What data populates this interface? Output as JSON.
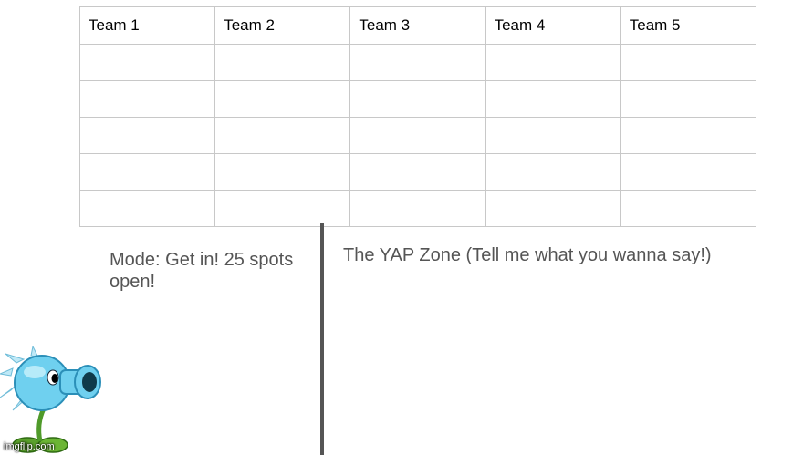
{
  "table": {
    "headers": [
      "Team 1",
      "Team 2",
      "Team 3",
      "Team 4",
      "Team 5"
    ],
    "rows": [
      [
        "",
        "",
        "",
        "",
        ""
      ],
      [
        "",
        "",
        "",
        "",
        ""
      ],
      [
        "",
        "",
        "",
        "",
        ""
      ],
      [
        "",
        "",
        "",
        "",
        ""
      ],
      [
        "",
        "",
        "",
        "",
        ""
      ]
    ]
  },
  "mode_text": "Mode: Get in! 25 spots open!",
  "yap_zone_text": "The YAP Zone (Tell me what you wanna say!)",
  "image": {
    "icon": "snow-pea-plant-icon"
  },
  "watermark": "imgflip.com",
  "colors": {
    "grid": "#c8c8c8",
    "divider": "#555555",
    "caption": "#555555"
  }
}
